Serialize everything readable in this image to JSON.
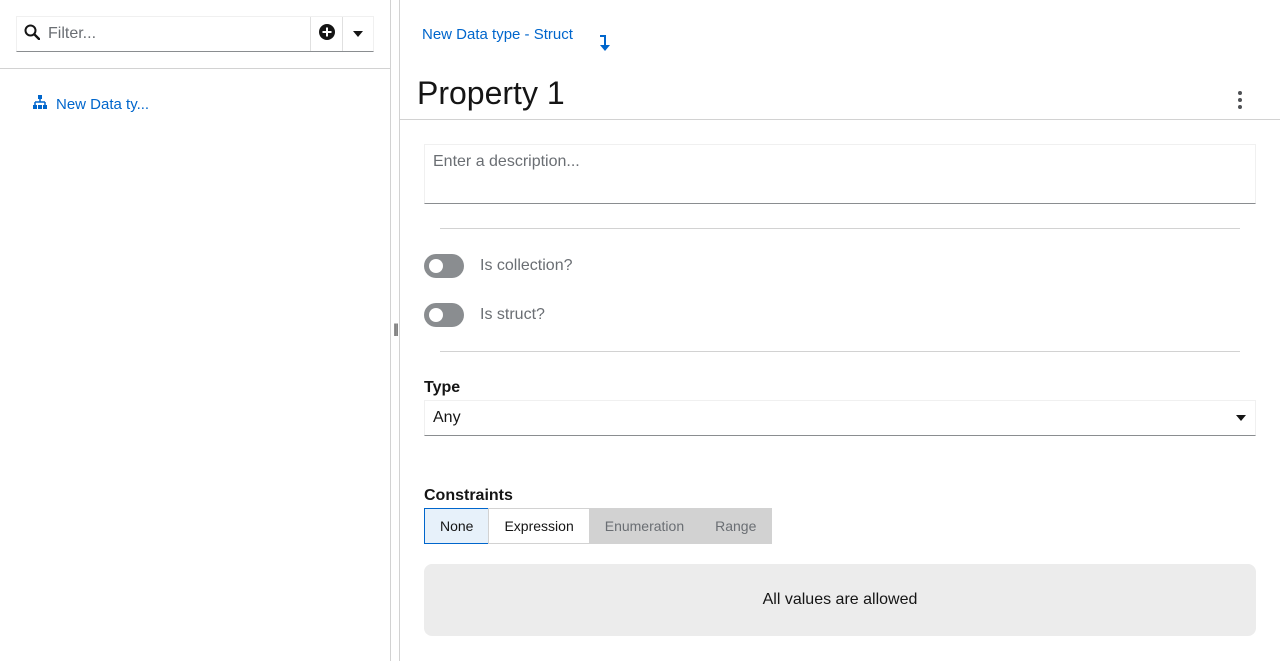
{
  "sidebar": {
    "filter": {
      "placeholder": "Filter...",
      "value": ""
    },
    "tree": [
      {
        "label": "New Data ty...",
        "icon": "data-type-tree-icon"
      }
    ]
  },
  "header": {
    "breadcrumb": "New Data type - Struct",
    "title": "Property 1"
  },
  "form": {
    "description_placeholder": "Enter a description...",
    "is_collection": {
      "label": "Is collection?",
      "checked": false
    },
    "is_struct": {
      "label": "Is struct?",
      "checked": false
    },
    "type_label": "Type",
    "type_value": "Any",
    "constraints_label": "Constraints",
    "constraints_options": [
      {
        "label": "None",
        "state": "selected"
      },
      {
        "label": "Expression",
        "state": "enabled"
      },
      {
        "label": "Enumeration",
        "state": "disabled"
      },
      {
        "label": "Range",
        "state": "disabled"
      }
    ],
    "allowed_message": "All values are allowed"
  },
  "colors": {
    "link": "#0066cc",
    "switch_off": "#8a8d90",
    "selected_bg": "#e7f1fa",
    "disabled_bg": "#d2d2d2",
    "panel_bg": "#ececec"
  }
}
